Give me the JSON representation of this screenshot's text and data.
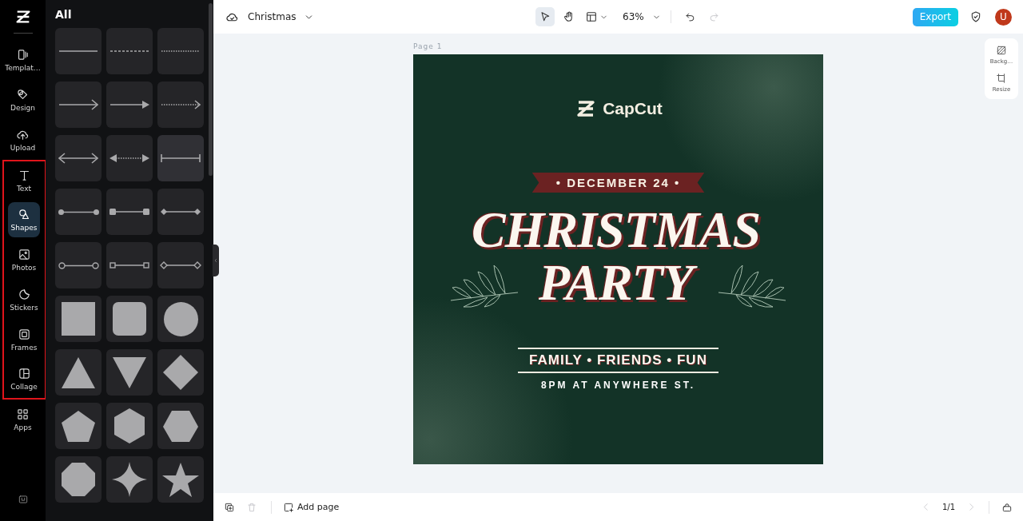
{
  "rail": {
    "items": [
      {
        "kind": "templates",
        "label": "Templat…",
        "selected": false,
        "highlighted": false
      },
      {
        "kind": "design",
        "label": "Design",
        "selected": false,
        "highlighted": false
      },
      {
        "kind": "upload",
        "label": "Upload",
        "selected": false,
        "highlighted": false
      },
      {
        "kind": "text",
        "label": "Text",
        "selected": false,
        "highlighted": true
      },
      {
        "kind": "shapes",
        "label": "Shapes",
        "selected": true,
        "highlighted": true
      },
      {
        "kind": "photos",
        "label": "Photos",
        "selected": false,
        "highlighted": true
      },
      {
        "kind": "stickers",
        "label": "Stickers",
        "selected": false,
        "highlighted": true
      },
      {
        "kind": "frames",
        "label": "Frames",
        "selected": false,
        "highlighted": true
      },
      {
        "kind": "collage",
        "label": "Collage",
        "selected": false,
        "highlighted": true
      },
      {
        "kind": "apps",
        "label": "Apps",
        "selected": false,
        "highlighted": false
      }
    ]
  },
  "panel": {
    "title": "All",
    "shapes": [
      {
        "kind": "line",
        "hovered": false
      },
      {
        "kind": "dashed-line",
        "hovered": false
      },
      {
        "kind": "dotted-line",
        "hovered": false
      },
      {
        "kind": "arrow",
        "hovered": false
      },
      {
        "kind": "solid-arrow",
        "hovered": false
      },
      {
        "kind": "dotted-arrow",
        "hovered": false
      },
      {
        "kind": "double-arrow",
        "hovered": false
      },
      {
        "kind": "dotted-double-arrow",
        "hovered": false
      },
      {
        "kind": "bracket-line",
        "hovered": true
      },
      {
        "kind": "dot-line",
        "hovered": false
      },
      {
        "kind": "square-end-line",
        "hovered": false
      },
      {
        "kind": "diamond-end-line",
        "hovered": false
      },
      {
        "kind": "ring-line",
        "hovered": false
      },
      {
        "kind": "open-square-line",
        "hovered": false
      },
      {
        "kind": "open-diamond-line",
        "hovered": false
      },
      {
        "kind": "square",
        "hovered": false
      },
      {
        "kind": "rounded-square",
        "hovered": false
      },
      {
        "kind": "circle",
        "hovered": false
      },
      {
        "kind": "triangle",
        "hovered": false
      },
      {
        "kind": "inverted-triangle",
        "hovered": false
      },
      {
        "kind": "diamond",
        "hovered": false
      },
      {
        "kind": "pentagon",
        "hovered": false
      },
      {
        "kind": "hexagon",
        "hovered": false
      },
      {
        "kind": "flat-hexagon",
        "hovered": false
      },
      {
        "kind": "octagon",
        "hovered": false
      },
      {
        "kind": "four-point-star",
        "hovered": false
      },
      {
        "kind": "star",
        "hovered": false
      }
    ]
  },
  "topbar": {
    "project_name": "Christmas",
    "zoom": "63%",
    "select_tool_selected": true,
    "redo_disabled": true,
    "export": "Export",
    "avatar": "U"
  },
  "canvas": {
    "page_label": "Page 1",
    "poster": {
      "brand": "CapCut",
      "date": "• DECEMBER 24 •",
      "title": "CHRISTMAS",
      "subtitle": "PARTY",
      "tagline": "FAMILY • FRIENDS • FUN",
      "location": "8PM AT ANYWHERE ST."
    }
  },
  "side_tools": [
    {
      "kind": "background",
      "label": "Backg…"
    },
    {
      "kind": "resize",
      "label": "Resize"
    }
  ],
  "bottombar": {
    "delete_disabled": true,
    "add_page": "Add page",
    "page_count": "1/1",
    "prev_disabled": true,
    "next_disabled": true
  }
}
